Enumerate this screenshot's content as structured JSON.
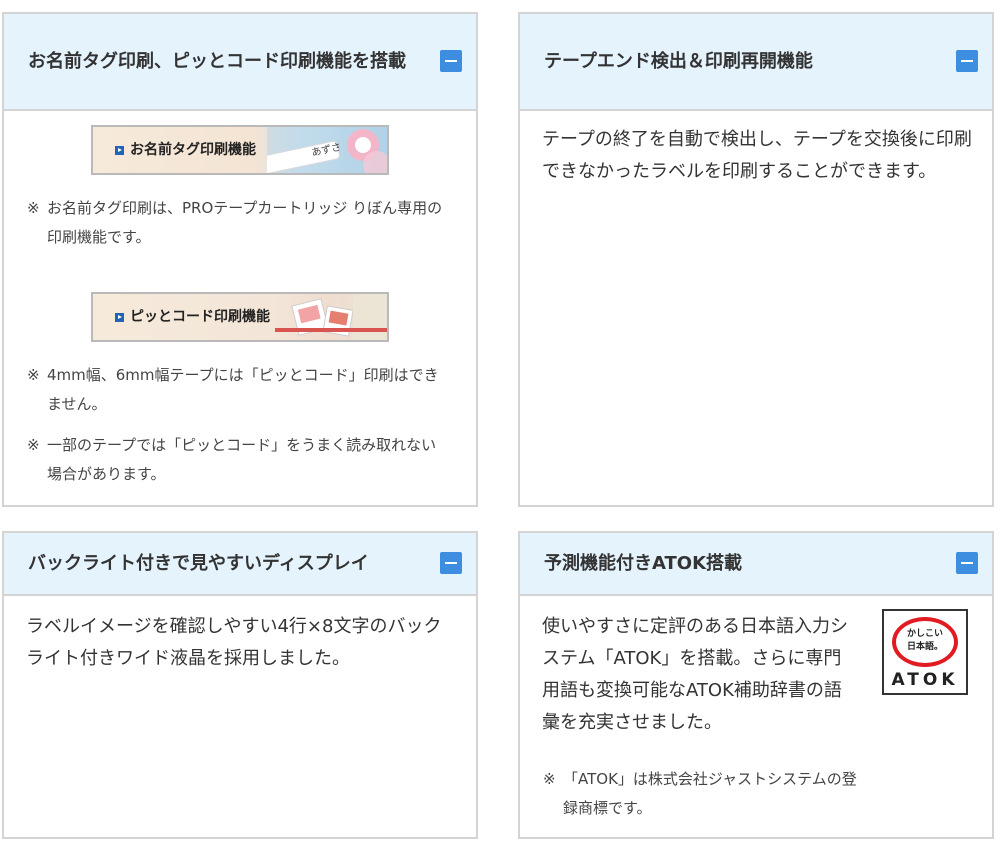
{
  "cards": {
    "name_tag": {
      "title": "お名前タグ印刷、ピッとコード印刷機能を搭載",
      "banner1_label": "お名前タグ印刷機能",
      "banner1_tag_text": "あずさ",
      "note1_mark": "※",
      "note1_text": "お名前タグ印刷は、PROテープカートリッジ りぼん専用の印刷機能です。",
      "banner2_label": "ピッとコード印刷機能",
      "note2_mark": "※",
      "note2_text": "4mm幅、6mm幅テープには「ピッとコード」印刷はできません。",
      "note3_mark": "※",
      "note3_text": "一部のテープでは「ピッとコード」をうまく読み取れない場合があります。"
    },
    "tape_end": {
      "title": "テープエンド検出＆印刷再開機能",
      "body": "テープの終了を自動で検出し、テープを交換後に印刷できなかったラベルを印刷することができます。"
    },
    "backlight": {
      "title": "バックライト付きで見やすいディスプレイ",
      "body": "ラベルイメージを確認しやすい4行×8文字のバックライト付きワイド液晶を採用しました。"
    },
    "atok": {
      "title": "予測機能付きATOK搭載",
      "body": "使いやすさに定評のある日本語入力システム「ATOK」を搭載。さらに専門用語も変換可能なATOK補助辞書の語彙を充実させました。",
      "note_mark": "※",
      "note_text": "「ATOK」は株式会社ジャストシステムの登録商標です。",
      "logo_line1": "かしこい",
      "logo_line2": "日本語。",
      "logo_word": "ATOK"
    }
  },
  "colors": {
    "header_bg": "#e5f3fd",
    "border": "#d4d4d4",
    "toggle_button": "#3d8ee0",
    "atok_red": "#e21b23",
    "text": "#333333"
  },
  "icons": [
    "minus-icon",
    "play-arrow-icon",
    "atok-logo"
  ]
}
